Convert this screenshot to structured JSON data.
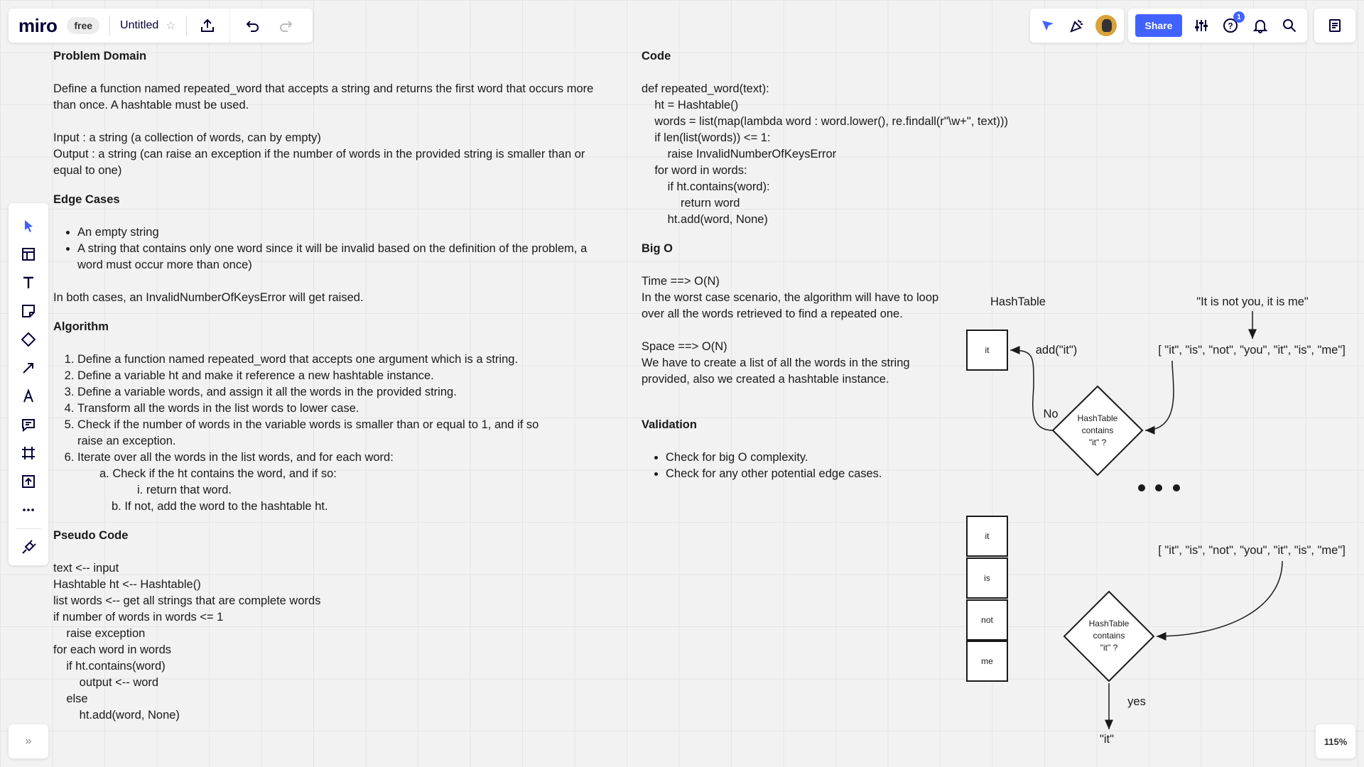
{
  "app": {
    "logo": "miro",
    "plan": "free",
    "board_title": "Untitled",
    "share_label": "Share",
    "help_badge": "1",
    "zoom": "115%",
    "expand_glyph": "»",
    "accent_color": "#4262ff"
  },
  "icons": {
    "top_left": [
      "star-icon",
      "export-icon",
      "undo-icon",
      "redo-icon"
    ],
    "top_right": [
      "voting-icon",
      "celebrate-icon",
      "avatar",
      "settings-sliders-icon",
      "help-icon",
      "bell-icon",
      "search-icon",
      "notes-icon"
    ],
    "left_toolbar": [
      "select-icon",
      "templates-icon",
      "text-icon",
      "sticky-note-icon",
      "shape-icon",
      "arrow-icon",
      "pen-icon",
      "comment-icon",
      "frame-icon",
      "upload-icon",
      "more-icon",
      "apps-icon"
    ]
  },
  "problem_domain": {
    "heading": "Problem Domain",
    "description": "Define a function named repeated_word that accepts a string and returns the first word that occurs more than once. A hashtable must be used.",
    "input": "Input : a string (a collection of words, can by empty)",
    "output": "Output : a string (can raise an exception if the number of words in the provided string is smaller than or equal to one)"
  },
  "edge_cases": {
    "heading": "Edge Cases",
    "items": [
      "An empty string",
      "A string that contains only one word since it will be invalid based on the definition of the problem, a word must occur more than once)"
    ],
    "note": "In both cases, an InvalidNumberOfKeysError will get raised."
  },
  "algorithm": {
    "heading": "Algorithm",
    "steps": [
      "Define a function named repeated_word that accepts one argument which is a string.",
      "Define a variable ht and make it reference a new hashtable instance.",
      "Define a variable words, and assign it all the words in the provided string.",
      "Transform all the words in the list words to lower case.",
      "Check if the number of words in the variable words is smaller than or equal to 1, and if so raise an exception.",
      "Iterate over all the words in the list words, and for each word:"
    ],
    "sub_a": "a. Check if the ht contains the word, and if so:",
    "sub_a_i": "i. return that word.",
    "sub_b": "b. If not, add the word to the hashtable ht."
  },
  "pseudo_code": {
    "heading": "Pseudo Code",
    "lines": [
      "text <-- input",
      "Hashtable ht <-- Hashtable()",
      "list words <-- get all strings that are complete words",
      "if number of words in words <= 1",
      "    raise exception",
      "for each word in words",
      "    if ht.contains(word)",
      "        output <-- word",
      "    else",
      "        ht.add(word, None)"
    ]
  },
  "code": {
    "heading": "Code",
    "lines": [
      "def repeated_word(text):",
      "    ht = Hashtable()",
      "    words = list(map(lambda word : word.lower(), re.findall(r\"\\w+\", text)))",
      "    if len(list(words)) <= 1:",
      "        raise InvalidNumberOfKeysError",
      "    for word in words:",
      "        if ht.contains(word):",
      "            return word",
      "        ht.add(word, None)"
    ]
  },
  "big_o": {
    "heading": "Big O",
    "time_title": "Time ==> O(N)",
    "time_desc": "In the worst case scenario, the algorithm will have to loop over all the words retrieved to find a repeated one.",
    "space_title": "Space ==> O(N)",
    "space_desc": "We have to create a list of all the words in the string provided, also we created a hashtable instance."
  },
  "validation": {
    "heading": "Validation",
    "items": [
      "Check for big O complexity.",
      "Check for any other potential edge cases."
    ]
  },
  "diagram": {
    "hashtable_label": "HashTable",
    "input_string": "\"It is not you, it is me\"",
    "word_list": "[ \"it\", \"is\", \"not\", \"you\", \"it\", \"is\", \"me\"]",
    "add_label": "add(\"it\")",
    "no_label": "No",
    "yes_label": "yes",
    "cell_1": "it",
    "decision_line1": "HashTable",
    "decision_line2": "contains",
    "decision_line3": "\"it\" ?",
    "cells_2": [
      "it",
      "is",
      "not",
      "me"
    ],
    "result": "\"it\""
  }
}
